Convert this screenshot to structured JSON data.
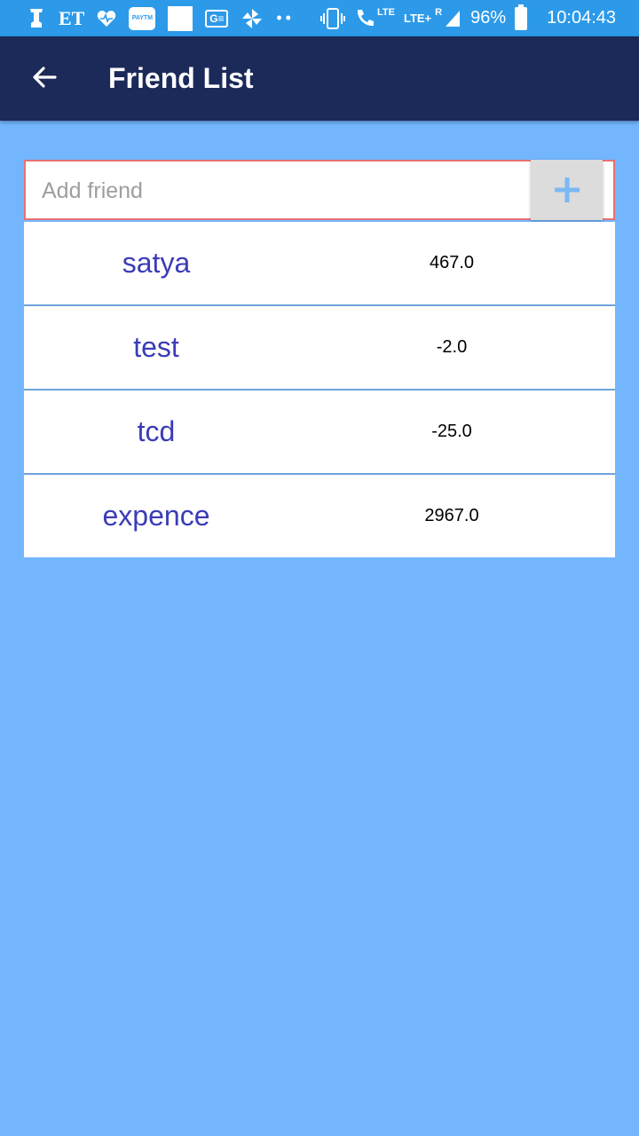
{
  "status_bar": {
    "carrier_text": "ET",
    "paytm_label": "PAYTM",
    "ge_label": "G≡",
    "lte1": "LTE",
    "lte2": "LTE+",
    "roaming": "R",
    "battery": "96%",
    "time": "10:04:43"
  },
  "app_bar": {
    "title": "Friend List"
  },
  "add_friend": {
    "value": "",
    "placeholder": "Add friend"
  },
  "friends": [
    {
      "name": "satya",
      "amount": "467.0"
    },
    {
      "name": "test",
      "amount": "-2.0"
    },
    {
      "name": "tcd",
      "amount": "-25.0"
    },
    {
      "name": "expence",
      "amount": "2967.0"
    }
  ],
  "colors": {
    "background": "#73b6fe",
    "status_bar": "#2c9ae9",
    "app_bar": "#1b2a59",
    "name_text": "#3b3cb7",
    "plus_icon": "#7ab9f5",
    "input_border": "#e57373"
  }
}
